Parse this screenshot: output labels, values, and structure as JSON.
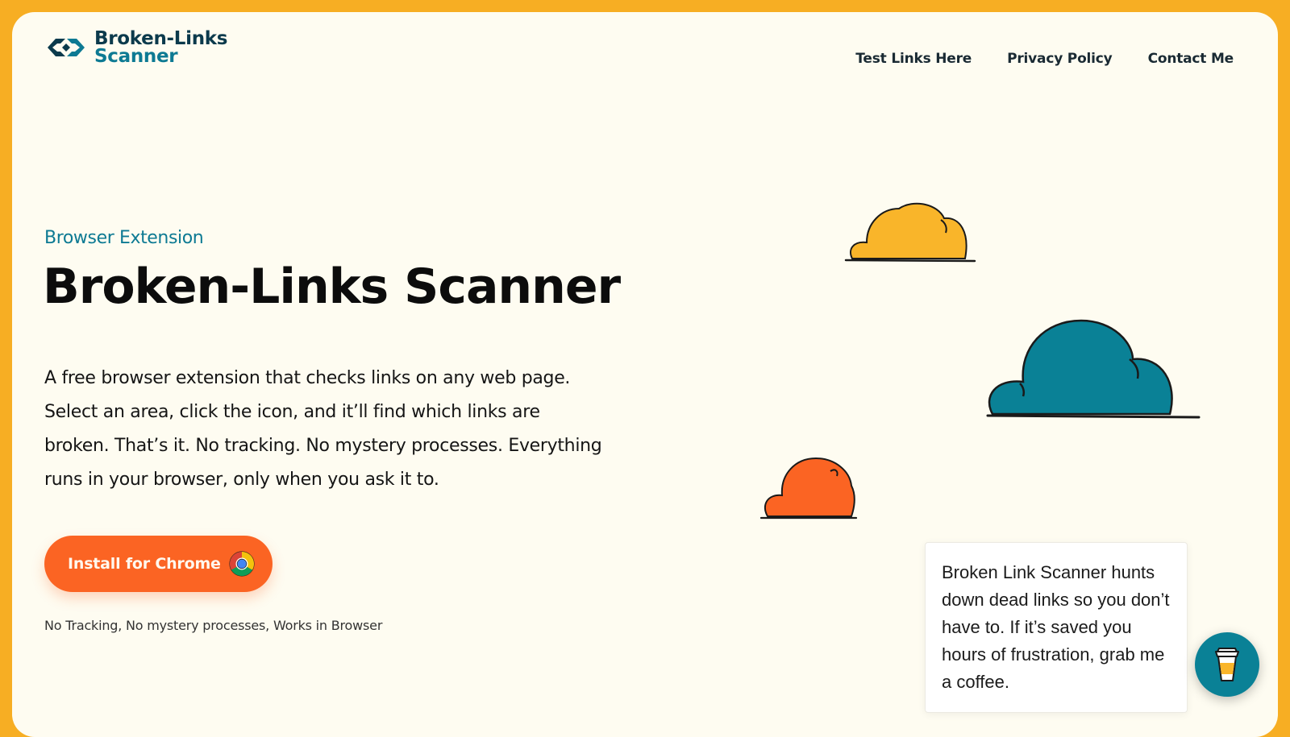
{
  "brand": {
    "name_line1": "Broken-Links",
    "name_line2": "Scanner",
    "color_dark": "#0B3A4C",
    "color_teal": "#0D7A93",
    "icon": "broken-chain-link-icon"
  },
  "nav": {
    "items": [
      {
        "label": "Test Links Here"
      },
      {
        "label": "Privacy Policy"
      },
      {
        "label": "Contact Me"
      }
    ]
  },
  "hero": {
    "eyebrow": "Browser Extension",
    "title": "Broken-Links Scanner",
    "description": "A free browser extension that checks links on any web page. Select an area, click the icon, and it’ll find which links are broken. That’s it. No tracking. No mystery processes. Everything runs in your browser, only when you ask it to.",
    "cta_label": "Install for Chrome",
    "cta_icon": "chrome-icon",
    "footnote": "No Tracking, No mystery processes, Works in Browser"
  },
  "decorations": {
    "clouds": [
      {
        "name": "cloud-yellow",
        "color": "#F9B52A"
      },
      {
        "name": "cloud-teal",
        "color": "#0A8196"
      },
      {
        "name": "cloud-orange",
        "color": "#FB6423"
      }
    ]
  },
  "coffee_widget": {
    "message": "Broken Link Scanner hunts down dead links so you don’t have to. If it’s saved you hours of frustration, grab me a coffee.",
    "button_icon": "coffee-cup-icon"
  },
  "colors": {
    "page_border": "#F7AE23",
    "page_background": "#FEFCF1",
    "accent_orange": "#FB6423",
    "accent_teal": "#0D7A93"
  }
}
